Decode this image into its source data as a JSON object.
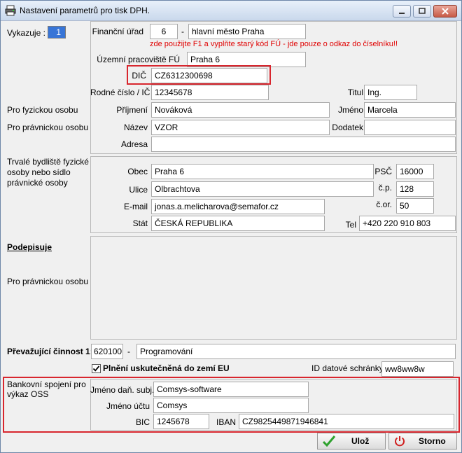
{
  "window": {
    "title": "Nastavení parametrů pro tisk DPH.",
    "icon": "printer-icon"
  },
  "left": {
    "vykazuje_label": "Vykazuje :",
    "vykazuje_value": "1",
    "pro_fyzickou": "Pro fyzickou osobu",
    "pro_pravnickou": "Pro právnickou osobu",
    "trvale_bydliste": [
      "Trvalé bydliště fyzické",
      "osoby nebo sídlo",
      "právnické osoby"
    ],
    "podepisuje": "Podepisuje",
    "pro_pravnickou_2": "Pro právnickou osobu",
    "prevazujici_cinnost": "Převažující činnost 1:",
    "bankovni_spojeni": [
      "Bankovní spojení pro",
      "výkaz OSS"
    ]
  },
  "fu": {
    "financni_urad_label": "Finanční úřad",
    "financni_urad_code": "6",
    "dash": "-",
    "financni_urad_name": "hlavní město Praha",
    "hint": "zde použijte F1 a vyplňte starý kód FÚ - jde pouze o odkaz do číselníku!!",
    "uzemni_label": "Územní pracoviště FÚ",
    "uzemni_value": "Praha 6"
  },
  "subject": {
    "dic_label": "DIČ",
    "dic_value": "CZ6312300698",
    "rodne_cislo_label": "Rodné číslo / IČ",
    "rodne_cislo_value": "12345678",
    "titul_label": "Titul",
    "titul_value": "Ing.",
    "prijmeni_label": "Příjmení",
    "prijmeni_value": "Nováková",
    "jmeno_label": "Jméno",
    "jmeno_value": "Marcela",
    "nazev_label": "Název",
    "nazev_value": "VZOR",
    "dodatek_label": "Dodatek",
    "dodatek_value": "",
    "adresa_label": "Adresa",
    "adresa_value": ""
  },
  "address": {
    "obec_label": "Obec",
    "obec_value": "Praha 6",
    "psc_label": "PSČ",
    "psc_value": "16000",
    "ulice_label": "Ulice",
    "ulice_value": "Olbrachtova",
    "cp_label": "č.p.",
    "cp_value": "128",
    "email_label": "E-mail",
    "email_value": "jonas.a.melicharova@semafor.cz",
    "cor_label": "č.or.",
    "cor_value": "50",
    "stat_label": "Stát",
    "stat_value": "ČESKÁ REPUBLIKA",
    "tel_label": "Tel",
    "tel_value": "+420 220 910 803"
  },
  "cinnost": {
    "code": "620100",
    "dash": "-",
    "name": "Programování"
  },
  "eu": {
    "checkbox_label": "Plnění uskutečněná do zemí EU",
    "checked": true,
    "id_schranky_label": "ID datové schránky",
    "id_schranky_value": "ww8ww8w"
  },
  "bank": {
    "jmeno_dan_label": "Jméno daň. subj.",
    "jmeno_dan_value": "Comsys-software",
    "jmeno_uctu_label": "Jméno účtu",
    "jmeno_uctu_value": "Comsys",
    "bic_label": "BIC",
    "bic_value": "1245678",
    "iban_label": "IBAN",
    "iban_value": "CZ9825449871946841"
  },
  "buttons": {
    "save_label": "Ulož",
    "cancel_label": "Storno"
  },
  "colors": {
    "highlight": "#d8262e",
    "hint": "#e00000",
    "save_check": "#2ea12e",
    "cancel_power": "#d02020"
  }
}
